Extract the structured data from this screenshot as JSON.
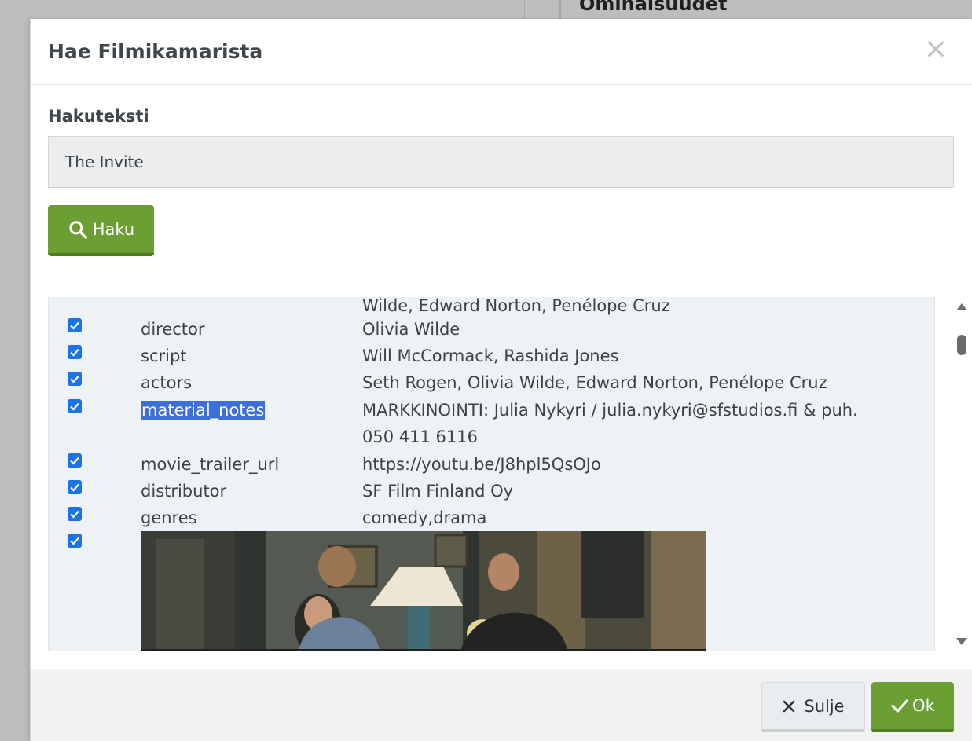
{
  "background": {
    "heading": "Ominaisuudet"
  },
  "modal": {
    "title": "Hae Filmikamarista",
    "close_icon": "close-icon"
  },
  "search": {
    "label": "Hakuteksti",
    "value": "The Invite",
    "button_label": "Haku",
    "button_icon": "search-icon"
  },
  "results": {
    "partial_top": "Wilde, Edward Norton, Penélope Cruz",
    "rows": [
      {
        "key": "director",
        "value": "Olivia Wilde",
        "checked": true
      },
      {
        "key": "script",
        "value": "Will McCormack, Rashida Jones",
        "checked": true
      },
      {
        "key": "actors",
        "value": "Seth Rogen, Olivia Wilde, Edward Norton, Penélope Cruz",
        "checked": true
      },
      {
        "key": "material_notes",
        "value": "MARKKINOINTI: Julia Nykyri / julia.nykyri@sfstudios.fi & puh.",
        "value_line2": "050 411 6116",
        "checked": true,
        "selected": true
      },
      {
        "key": "movie_trailer_url",
        "value": "https://youtu.be/J8hpl5QsOJo",
        "checked": true
      },
      {
        "key": "distributor",
        "value": "SF Film Finland Oy",
        "checked": true
      },
      {
        "key": "genres",
        "value": "comedy,drama",
        "checked": true
      },
      {
        "key": "",
        "value": "",
        "checked": true,
        "image": "film-still"
      }
    ]
  },
  "footer": {
    "close_label": "Sulje",
    "ok_label": "Ok"
  },
  "colors": {
    "primary_green": "#6b9f33",
    "checkbox_blue": "#1a73e8",
    "selection_blue": "#3d6fd6"
  }
}
